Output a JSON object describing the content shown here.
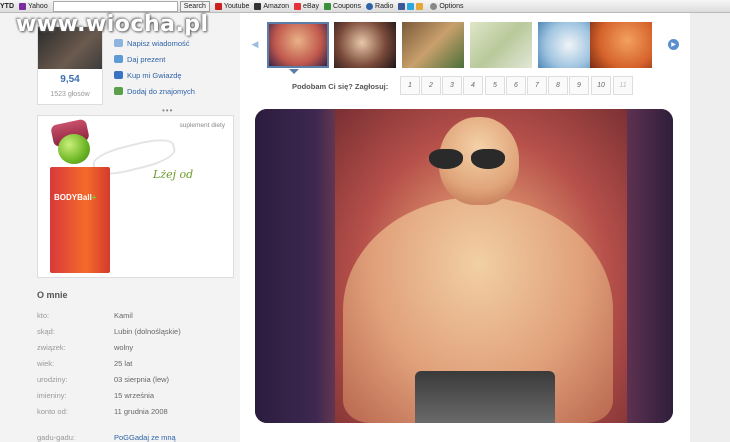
{
  "toolbar": {
    "ytd": "YTD",
    "yahoo": "Yahoo",
    "search_btn": "Search",
    "youtube": "Youtube",
    "amazon": "Amazon",
    "ebay": "eBay",
    "coupons": "Coupons",
    "radio": "Radio",
    "options": "Options"
  },
  "watermark": "www.wiocha.pl",
  "profile": {
    "score": "9,54",
    "votes": "1523 głosów",
    "actions": [
      "Napisz wiadomość",
      "Daj prezent",
      "Kup mi Gwiazdę",
      "Dodaj do znajomych"
    ],
    "more": "•••"
  },
  "ad": {
    "label": "suplement diety",
    "slogan": "Lżej od",
    "brand": "BODYBall",
    "brand_plus": "+"
  },
  "about": {
    "title": "O mnie",
    "rows": [
      {
        "k": "kto:",
        "v": "Kamil"
      },
      {
        "k": "skąd:",
        "v": "Lubin (dolnośląskie)"
      },
      {
        "k": "związek:",
        "v": "wolny"
      },
      {
        "k": "wiek:",
        "v": "25 lat"
      },
      {
        "k": "urodziny:",
        "v": "03 sierpnia (lew)"
      },
      {
        "k": "imieniny:",
        "v": "15 września"
      },
      {
        "k": "konto od:",
        "v": "11 grudnia 2008"
      }
    ],
    "gadu_label": "gadu-gadu:",
    "gadu_value": "PoGGadaj ze mną"
  },
  "voting": {
    "label": "Podobam Ci się? Zagłosuj:",
    "buttons": [
      "1",
      "2",
      "3",
      "4",
      "5",
      "6",
      "7",
      "8",
      "9",
      "10",
      "11"
    ]
  },
  "colors": {
    "link": "#2f63a8",
    "thumb_selected": "#5b7ea8"
  }
}
